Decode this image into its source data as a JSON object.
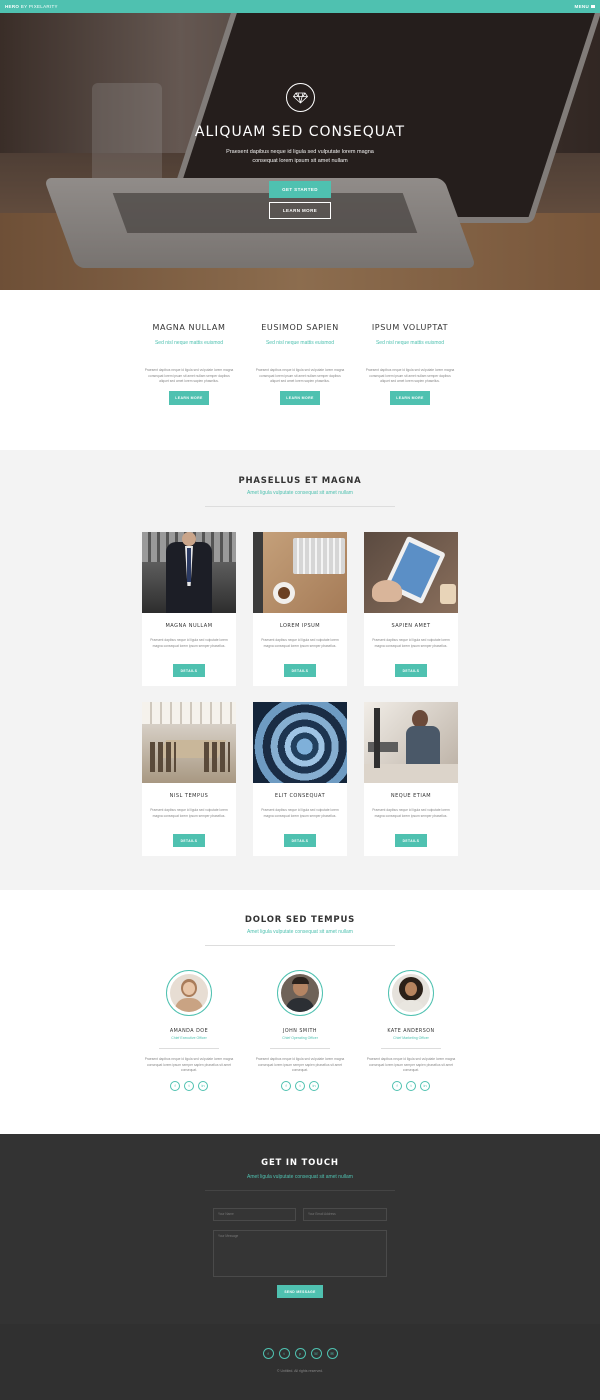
{
  "topbar": {
    "brand": "HERO",
    "brand_suffix": "BY PIXELARITY",
    "menu_label": "MENU"
  },
  "hero": {
    "title": "ALIQUAM SED CONSEQUAT",
    "subtitle": "Praesent dapibus neque id ligula sed vulputate lorem magna consequat lorem ipsum sit amet nullam",
    "primary_button": "GET STARTED",
    "secondary_button": "LEARN MORE"
  },
  "features": [
    {
      "title": "MAGNA NULLAM",
      "tagline": "Sed nisl neque mattis euismod",
      "text": "Praesent dapibus neque id ligula sed vulputate lorem magna consequat lorem ipsum sit amet nullam semper dapibus aliquet sed amet lorem sapien phasellus.",
      "button": "LEARN MORE"
    },
    {
      "title": "EUSIMOD SAPIEN",
      "tagline": "Sed nisl neque mattis euismod",
      "text": "Praesent dapibus neque id ligula sed vulputate lorem magna consequat lorem ipsum sit amet nullam semper dapibus aliquet sed amet lorem sapien phasellus.",
      "button": "LEARN MORE"
    },
    {
      "title": "IPSUM VOLUPTAT",
      "tagline": "Sed nisl neque mattis euismod",
      "text": "Praesent dapibus neque id ligula sed vulputate lorem magna consequat lorem ipsum sit amet nullam semper dapibus aliquet sed amet lorem sapien phasellus.",
      "button": "LEARN MORE"
    }
  ],
  "portfolio": {
    "title": "PHASELLUS ET MAGNA",
    "subtitle": "Amet ligula vulputate consequat sit amet nullam",
    "cards": [
      {
        "title": "MAGNA NULLAM",
        "text": "Praesent dapibus neque id ligula sed vulputate lorem magna consequat lorem ipsum semper phasellus.",
        "button": "DETAILS"
      },
      {
        "title": "LOREM IPSUM",
        "text": "Praesent dapibus neque id ligula sed vulputate lorem magna consequat lorem ipsum semper phasellus.",
        "button": "DETAILS"
      },
      {
        "title": "SAPIEN AMET",
        "text": "Praesent dapibus neque id ligula sed vulputate lorem magna consequat lorem ipsum semper phasellus.",
        "button": "DETAILS"
      },
      {
        "title": "NISL TEMPUS",
        "text": "Praesent dapibus neque id ligula sed vulputate lorem magna consequat lorem ipsum semper phasellus.",
        "button": "DETAILS"
      },
      {
        "title": "ELIT CONSEQUAT",
        "text": "Praesent dapibus neque id ligula sed vulputate lorem magna consequat lorem ipsum semper phasellus.",
        "button": "DETAILS"
      },
      {
        "title": "NEQUE ETIAM",
        "text": "Praesent dapibus neque id ligula sed vulputate lorem magna consequat lorem ipsum semper phasellus.",
        "button": "DETAILS"
      }
    ]
  },
  "team": {
    "title": "DOLOR SED TEMPUS",
    "subtitle": "Amet ligula vulputate consequat sit amet nullam",
    "members": [
      {
        "name": "AMANDA DOE",
        "role": "Chief Executive Officer",
        "text": "Praesent dapibus neque id ligula sed vulputate lorem magna consequat lorem ipsum semper sapien phasellus sit amet consequat."
      },
      {
        "name": "JOHN SMITH",
        "role": "Chief Operating Officer",
        "text": "Praesent dapibus neque id ligula sed vulputate lorem magna consequat lorem ipsum semper sapien phasellus sit amet consequat."
      },
      {
        "name": "KATE ANDERSON",
        "role": "Chief Marketing Officer",
        "text": "Praesent dapibus neque id ligula sed vulputate lorem magna consequat lorem ipsum semper sapien phasellus sit amet consequat."
      }
    ]
  },
  "contact": {
    "title": "GET IN TOUCH",
    "subtitle": "Amet ligula vulputate consequat sit amet nullam",
    "name_placeholder": "Your Name",
    "email_placeholder": "Your Email Address",
    "message_placeholder": "Your Message",
    "send_button": "SEND MESSAGE"
  },
  "footer": {
    "copyright": "© Untitled. All rights reserved."
  },
  "colors": {
    "accent": "#4fc1b0",
    "dark": "#333333",
    "light_bg": "#f3f3f3"
  },
  "icons": [
    "diamond-icon",
    "menu-icon",
    "facebook-icon",
    "twitter-icon",
    "linkedin-icon",
    "pinterest-icon",
    "phone-icon",
    "email-icon"
  ]
}
